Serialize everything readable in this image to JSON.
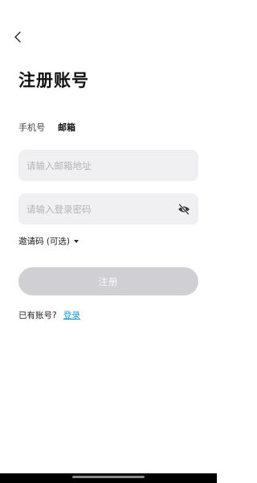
{
  "header": {
    "back_icon": "chevron-left-icon"
  },
  "page": {
    "title": "注册账号"
  },
  "tabs": [
    {
      "label": "手机号",
      "active": false
    },
    {
      "label": "邮箱",
      "active": true
    }
  ],
  "form": {
    "email": {
      "value": "",
      "placeholder": "请输入邮箱地址"
    },
    "password": {
      "value": "",
      "placeholder": "请输入登录密码",
      "toggle_icon": "eye-off-icon"
    },
    "invite_code_label": "邀请码 (可选)",
    "invite_toggle_icon": "caret-down-icon",
    "submit_label": "注册"
  },
  "footer": {
    "prompt": "已有账号?",
    "login_label": "登录"
  },
  "colors": {
    "accent": "#1c9bd3",
    "input_bg": "#f0f0f2",
    "button_disabled_bg": "#d0d0d4",
    "nav_bar": "#000000"
  }
}
